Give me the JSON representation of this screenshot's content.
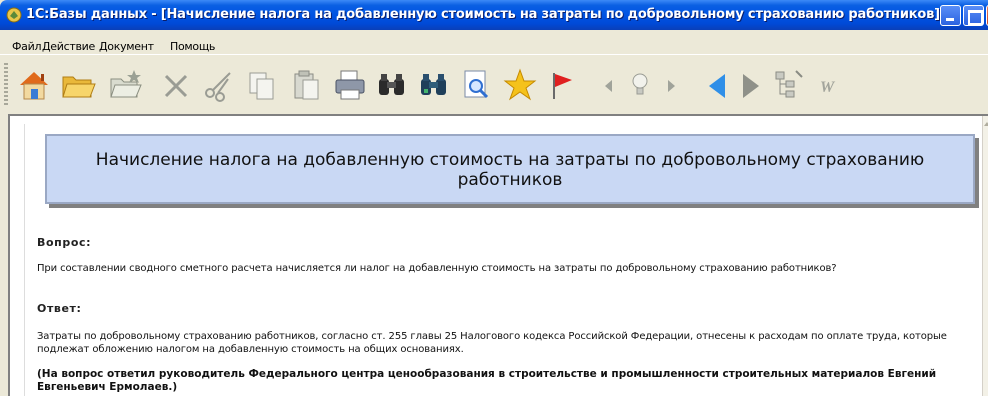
{
  "window": {
    "title": "1С:Базы данных - [Начисление налога на добавленную стоимость на затраты по добровольному страхованию работников]"
  },
  "menu": [
    {
      "label": "Файл"
    },
    {
      "label": "Действие"
    },
    {
      "label": "Документ"
    },
    {
      "label": "Помощь"
    }
  ],
  "toolbar": {
    "buttons": [
      {
        "name": "home-icon"
      },
      {
        "name": "open-folder-icon"
      },
      {
        "name": "new-folder-icon"
      },
      {
        "name": "delete-icon"
      },
      {
        "name": "cut-icon"
      },
      {
        "name": "copy-icon"
      },
      {
        "name": "paste-icon"
      },
      {
        "name": "print-icon"
      },
      {
        "name": "find-icon"
      },
      {
        "name": "find-next-icon"
      },
      {
        "name": "preview-icon"
      },
      {
        "name": "favorites-star-icon"
      },
      {
        "name": "bookmark-flag-icon"
      },
      {
        "name": "prev-small-icon"
      },
      {
        "name": "hint-bulb-icon"
      },
      {
        "name": "next-small-icon"
      },
      {
        "name": "back-icon"
      },
      {
        "name": "forward-icon"
      },
      {
        "name": "tree-icon"
      },
      {
        "name": "word-icon"
      }
    ],
    "colors": {
      "accent_blue": "#2f8fe8",
      "star": "#f5c21b",
      "flag": "#e02020"
    }
  },
  "document": {
    "banner_title": "Начисление налога на добавленную стоимость на затраты по добровольному страхованию работников",
    "question_heading": "Вопрос:",
    "question_text": "При составлении сводного сметного расчета начисляется ли налог на добавленную стоимость на затраты по добровольному страхованию работников?",
    "answer_heading": "Ответ:",
    "answer_text": "Затраты по добровольному страхованию работников, согласно ст. 255 главы 25 Налогового кодекса Российской Федерации, отнесены к расходам по оплате труда, которые подлежат обложению налогом на добавленную стоимость на общих основаниях.",
    "answered_by": "(На вопрос ответил руководитель Федерального центра ценообразования в строительстве и промышленности строительных материалов Евгений Евгеньевич Ермолаев.)"
  }
}
